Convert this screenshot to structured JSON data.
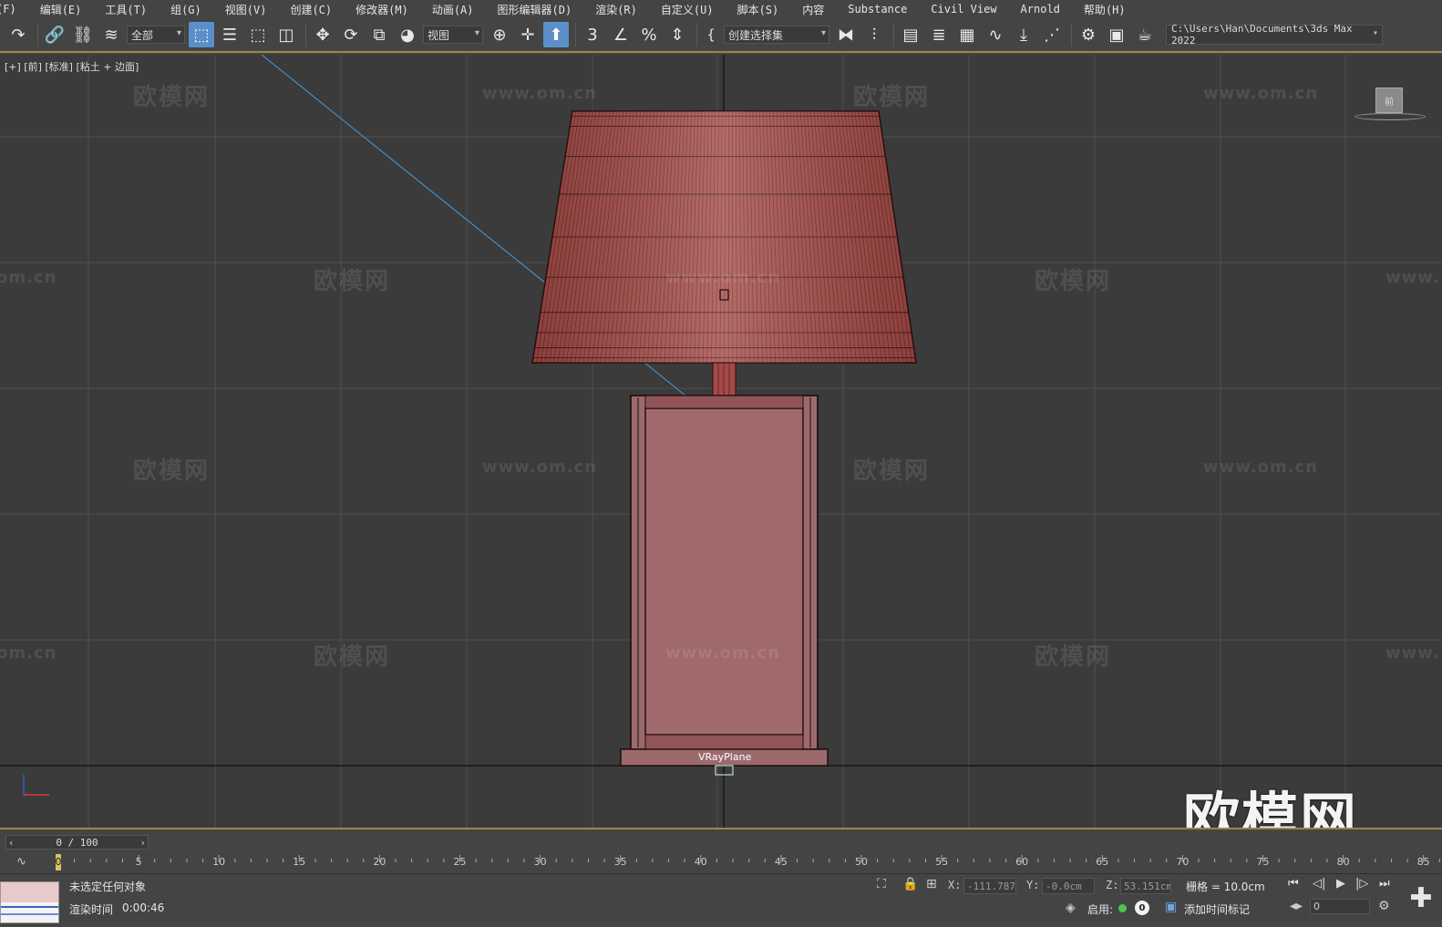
{
  "menu": [
    "(F)",
    "编辑(E)",
    "工具(T)",
    "组(G)",
    "视图(V)",
    "创建(C)",
    "修改器(M)",
    "动画(A)",
    "图形编辑器(D)",
    "渲染(R)",
    "自定义(U)",
    "脚本(S)",
    "内容",
    "Substance",
    "Civil View",
    "Arnold",
    "帮助(H)"
  ],
  "toolbar": {
    "selection_filter": "全部",
    "reference_coord": "视图",
    "named_selection": "创建选择集",
    "project_path": "C:\\Users\\Han\\Documents\\3ds Max 2022"
  },
  "viewport": {
    "label": "[+] [前] [标准] [粘土 + 边面]",
    "object_label": "VRayPlane",
    "viewcube_label": "前",
    "watermark_text": "欧模网",
    "watermark_url": "www.om.cn",
    "watermark_url_partial": "om.cn",
    "watermark_url_cut": "www.",
    "watermark_big": "欧模网",
    "colors": {
      "lamp": "#a54b47",
      "base": "#9c6a6c",
      "grid": "#4f4f4f",
      "wire": "#4a9ad8"
    }
  },
  "timeline": {
    "frame_display": "0 / 100",
    "ticks": [
      "0",
      "5",
      "10",
      "15",
      "20",
      "25",
      "30",
      "35",
      "40",
      "45",
      "50",
      "55",
      "60",
      "65",
      "70",
      "75",
      "80",
      "85"
    ]
  },
  "status": {
    "selection_text": "未选定任何对象",
    "render_time_label": "渲染时间",
    "render_time_value": "0:00:46",
    "x_label": "X:",
    "x_value": "-111.787c",
    "y_label": "Y:",
    "y_value": "-0.0cm",
    "z_label": "Z:",
    "z_value": "53.151cm",
    "grid_text": "栅格 = 10.0cm",
    "enable_label": "启用:",
    "enable_count": "0",
    "add_time_tag": "添加时间标记",
    "current_frame": "0"
  }
}
